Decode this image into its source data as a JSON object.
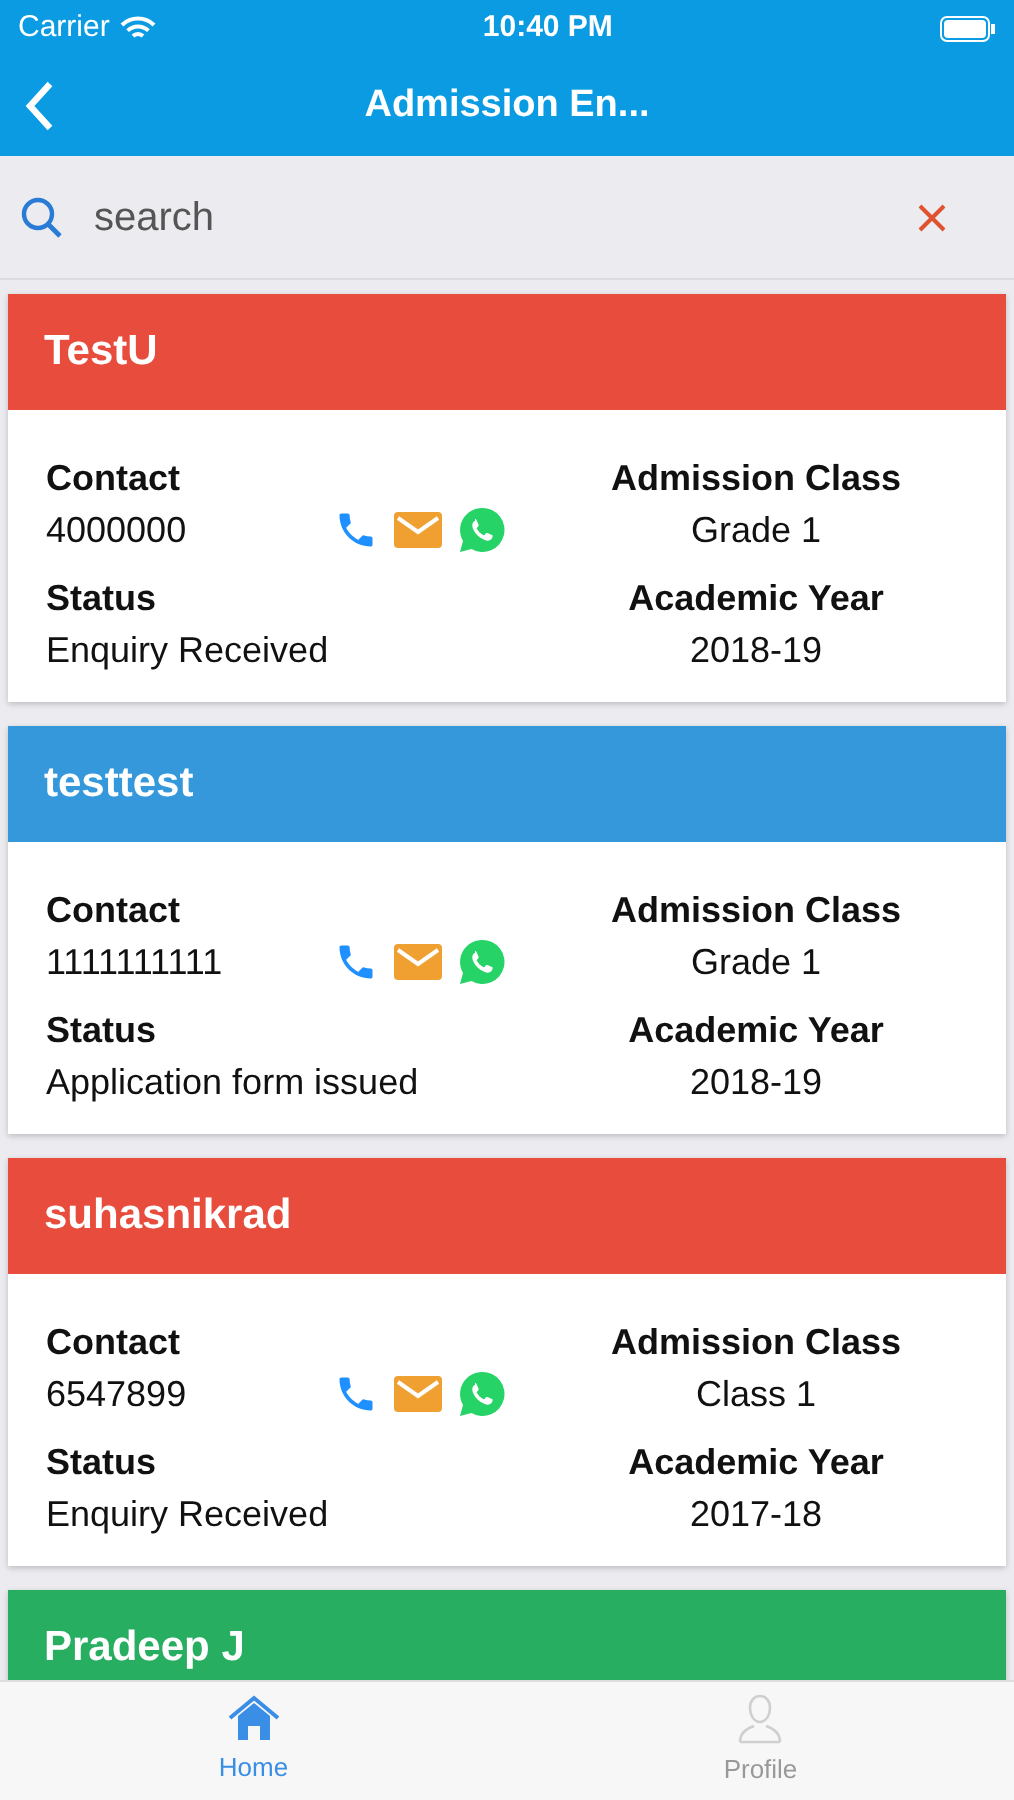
{
  "status_bar": {
    "carrier": "Carrier",
    "time": "10:40 PM"
  },
  "nav": {
    "title": "Admission En..."
  },
  "search": {
    "placeholder": "search"
  },
  "cards": [
    {
      "name": "TestU",
      "color": "#e74c3c",
      "contact_label": "Contact",
      "contact": "4000000",
      "class_label": "Admission Class",
      "class": "Grade 1",
      "status_label": "Status",
      "status": "Enquiry Received",
      "year_label": "Academic Year",
      "year": "2018-19"
    },
    {
      "name": "testtest",
      "color": "#3498db",
      "contact_label": "Contact",
      "contact": "1111111111",
      "class_label": "Admission Class",
      "class": "Grade 1",
      "status_label": "Status",
      "status": "Application form issued",
      "year_label": "Academic Year",
      "year": "2018-19"
    },
    {
      "name": "suhasnikrad",
      "color": "#e74c3c",
      "contact_label": "Contact",
      "contact": "6547899",
      "class_label": "Admission Class",
      "class": "Class 1",
      "status_label": "Status",
      "status": "Enquiry Received",
      "year_label": "Academic Year",
      "year": "2017-18"
    },
    {
      "name": "Pradeep J",
      "color": "#27ae60"
    }
  ],
  "tabs": [
    {
      "label": "Home",
      "kind": "home",
      "selected": true
    },
    {
      "label": "Profile",
      "kind": "profile",
      "selected": false
    }
  ]
}
